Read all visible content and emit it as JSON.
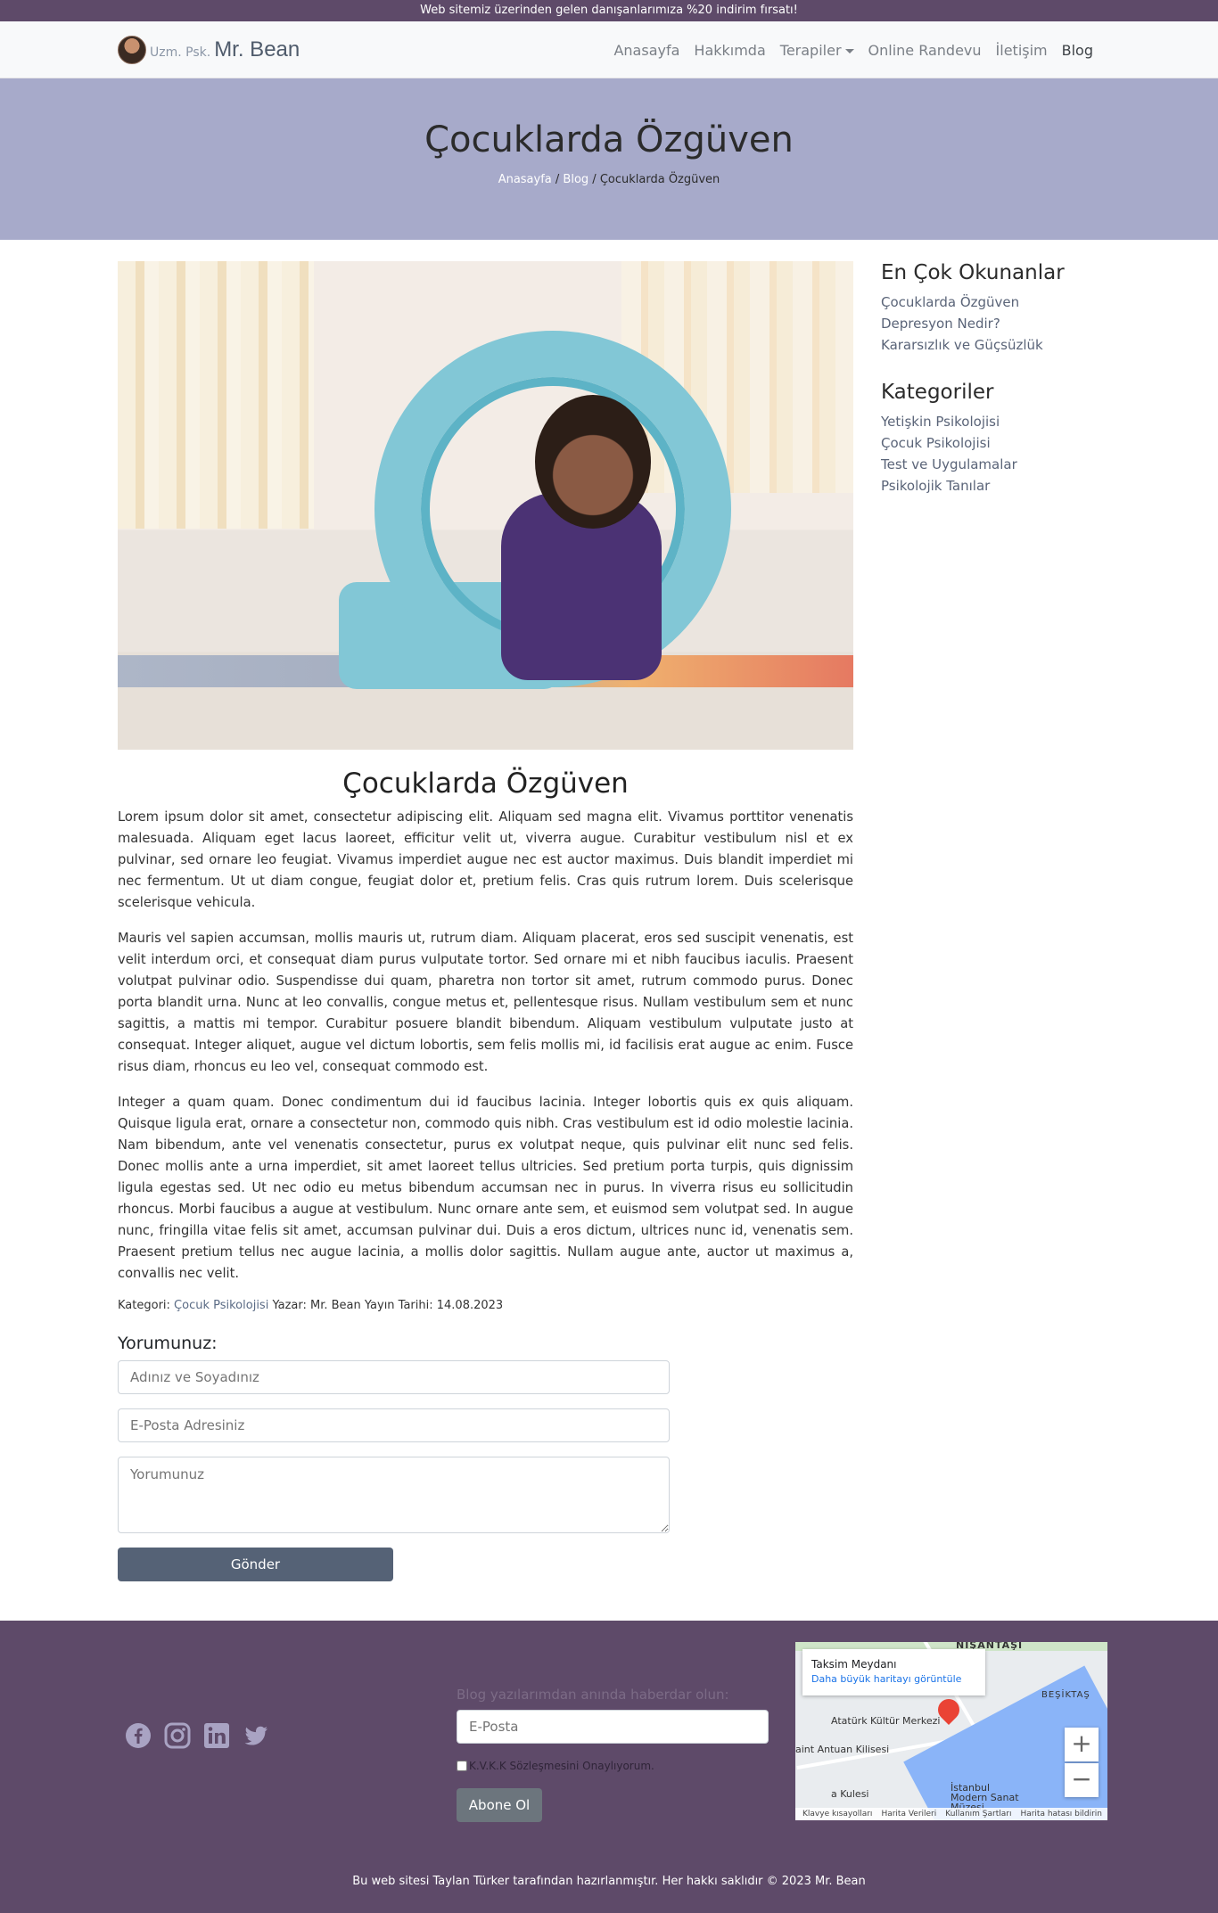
{
  "topbar": {
    "text": "Web sitemiz üzerinden gelen danışanlarımıza %20 indirim fırsatı!"
  },
  "brand": {
    "prefix": "Uzm. Psk.",
    "name": "Mr. Bean"
  },
  "nav": {
    "items": [
      {
        "label": "Anasayfa"
      },
      {
        "label": "Hakkımda"
      },
      {
        "label": "Terapiler"
      },
      {
        "label": "Online Randevu"
      },
      {
        "label": "İletişim"
      },
      {
        "label": "Blog"
      }
    ]
  },
  "hero": {
    "title": "Çocuklarda Özgüven",
    "breadcrumb": {
      "home": "Anasayfa",
      "sep1": " / ",
      "blog": "Blog",
      "sep2": " / ",
      "current": "Çocuklarda Özgüven"
    }
  },
  "post": {
    "title": "Çocuklarda Özgüven",
    "paragraphs": [
      "Lorem ipsum dolor sit amet, consectetur adipiscing elit. Aliquam sed magna elit. Vivamus porttitor venenatis malesuada. Aliquam eget lacus laoreet, efficitur velit ut, viverra augue. Curabitur vestibulum nisl et ex pulvinar, sed ornare leo feugiat. Vivamus imperdiet augue nec est auctor maximus. Duis blandit imperdiet mi nec fermentum. Ut ut diam congue, feugiat dolor et, pretium felis. Cras quis rutrum lorem. Duis scelerisque scelerisque vehicula.",
      "Mauris vel sapien accumsan, mollis mauris ut, rutrum diam. Aliquam placerat, eros sed suscipit venenatis, est velit interdum orci, et consequat diam purus vulputate tortor. Sed ornare mi et nibh faucibus iaculis. Praesent volutpat pulvinar odio. Suspendisse dui quam, pharetra non tortor sit amet, rutrum commodo purus. Donec porta blandit urna. Nunc at leo convallis, congue metus et, pellentesque risus. Nullam vestibulum sem et nunc sagittis, a mattis mi tempor. Curabitur posuere blandit bibendum. Aliquam vestibulum vulputate justo at consequat. Integer aliquet, augue vel dictum lobortis, sem felis mollis mi, id facilisis erat augue ac enim. Fusce risus diam, rhoncus eu leo vel, consequat commodo est.",
      "Integer a quam quam. Donec condimentum dui id faucibus lacinia. Integer lobortis quis ex quis aliquam. Quisque ligula erat, ornare a consectetur non, commodo quis nibh. Cras vestibulum est id odio molestie lacinia. Nam bibendum, ante vel venenatis consectetur, purus ex volutpat neque, quis pulvinar elit nunc sed felis. Donec mollis ante a urna imperdiet, sit amet laoreet tellus ultricies. Sed pretium porta turpis, quis dignissim ligula egestas sed. Ut nec odio eu metus bibendum accumsan nec in purus. In viverra risus eu sollicitudin rhoncus. Morbi faucibus a augue at vestibulum. Nunc ornare ante sem, et euismod sem volutpat sed. In augue nunc, fringilla vitae felis sit amet, accumsan pulvinar dui. Duis a eros dictum, ultrices nunc id, venenatis sem. Praesent pretium tellus nec augue lacinia, a mollis dolor sagittis. Nullam augue ante, auctor ut maximus a, convallis nec velit."
    ],
    "meta": {
      "category_label": "Kategori: ",
      "category": "Çocuk Psikolojisi",
      "author_text": " Yazar: Mr. Bean Yayın Tarihi: 14.08.2023"
    }
  },
  "comment": {
    "heading": "Yorumunuz:",
    "name_placeholder": "Adınız ve Soyadınız",
    "email_placeholder": "E-Posta Adresiniz",
    "comment_placeholder": "Yorumunuz",
    "submit": "Gönder"
  },
  "sidebar": {
    "popular_title": "En Çok Okunanlar",
    "popular": [
      "Çocuklarda Özgüven",
      "Depresyon Nedir?",
      "Kararsızlık ve Güçsüzlük"
    ],
    "categories_title": "Kategoriler",
    "categories": [
      "Yetişkin Psikolojisi",
      "Çocuk Psikolojisi",
      "Test ve Uygulamalar",
      "Psikolojik Tanılar"
    ]
  },
  "footer": {
    "socials": [
      "facebook-icon",
      "instagram-icon",
      "linkedin-icon",
      "twitter-icon"
    ],
    "subscribe_label": "Blog yazılarımdan anında haberdar olun:",
    "email_placeholder": "E-Posta",
    "kvkk": "K.V.K.K Sözleşmesini Onaylıyorum.",
    "subscribe_button": "Abone Ol",
    "map": {
      "place": "Taksim Meydanı",
      "link": "Daha büyük haritayı görüntüle",
      "label_top": "NIŞANTAŞI",
      "label_besiktas": "BEŞİKTAŞ",
      "label_akm": "Atatürk Kültür Merkezi",
      "label_church": "aint Antuan Kilisesi",
      "label_museum": "İstanbul Modern Sanat Müzesi",
      "label_tower": "a Kulesi",
      "footer_links": [
        "Klavye kısayolları",
        "Harita Verileri",
        "Kullanım Şartları",
        "Harita hatası bildirin"
      ]
    },
    "copyright": "Bu web sitesi Taylan Türker tarafından hazırlanmıştır. Her hakkı saklıdır © 2023 Mr. Bean"
  },
  "colors": {
    "topbar": "#5e4a69",
    "hero": "#a7aaca",
    "button": "#556276",
    "footer": "#5e4a69"
  }
}
